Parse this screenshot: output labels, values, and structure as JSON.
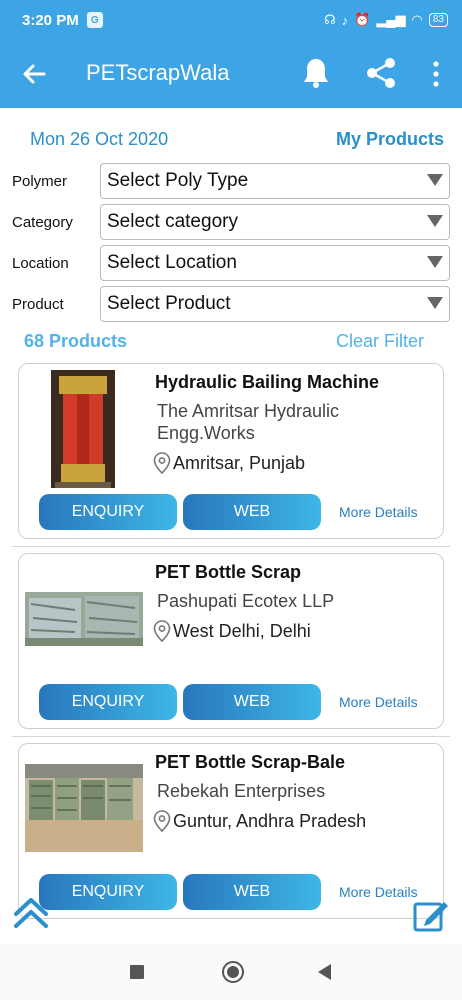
{
  "status_bar": {
    "time": "3:20 PM",
    "g_icon": "G",
    "battery": "83"
  },
  "app_bar": {
    "title": "PETscrapWala"
  },
  "header": {
    "date": "Mon 26 Oct 2020",
    "my_products": "My Products"
  },
  "filters": [
    {
      "label": "Polymer",
      "value": "Select Poly Type"
    },
    {
      "label": "Category",
      "value": "Select category"
    },
    {
      "label": "Location",
      "value": "Select Location"
    },
    {
      "label": "Product",
      "value": "Select Product"
    }
  ],
  "summary": {
    "count": "68 Products",
    "clear": "Clear Filter"
  },
  "products": [
    {
      "name": "Hydraulic Bailing Machine",
      "company": "The Amritsar Hydraulic Engg.Works",
      "location": "Amritsar, Punjab",
      "enquiry": "ENQUIRY",
      "web": "WEB",
      "details": "More Details"
    },
    {
      "name": "PET Bottle Scrap",
      "company": "Pashupati Ecotex LLP",
      "location": "West Delhi, Delhi",
      "enquiry": "ENQUIRY",
      "web": "WEB",
      "details": "More Details"
    },
    {
      "name": "PET Bottle Scrap-Bale",
      "company": "Rebekah Enterprises",
      "location": "Guntur, Andhra Pradesh",
      "enquiry": "ENQUIRY",
      "web": "WEB",
      "details": "More Details"
    }
  ],
  "colors": {
    "primary": "#3da4e6",
    "accent_text": "#2a8fcb",
    "button_from": "#2877bd",
    "button_to": "#3eb6e6"
  },
  "icons": [
    "back-arrow-icon",
    "bell-icon",
    "share-icon",
    "more-vert-icon",
    "location-pin-icon",
    "scroll-up-icon",
    "edit-icon"
  ]
}
